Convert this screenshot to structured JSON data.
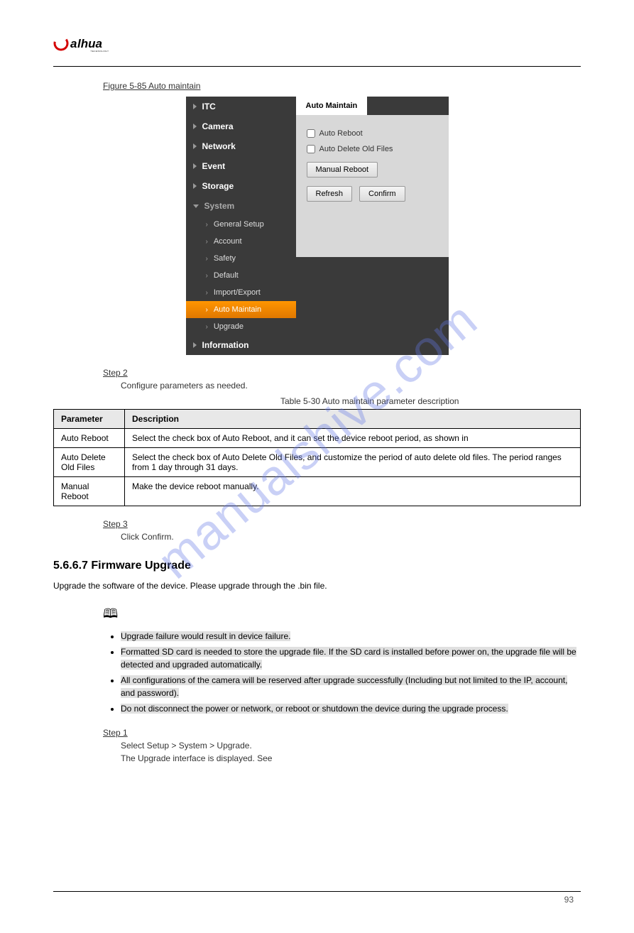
{
  "logo": {
    "brand": "alhua",
    "sub": "TECHNOLOGY"
  },
  "watermark": "manualshive.com",
  "figure_label": "Figure 5-85",
  "figure_title": "Auto maintain",
  "sidebar": {
    "items": [
      {
        "label": "ITC"
      },
      {
        "label": "Camera"
      },
      {
        "label": "Network"
      },
      {
        "label": "Event"
      },
      {
        "label": "Storage"
      }
    ],
    "active_section": "System",
    "subitems": [
      {
        "label": "General Setup"
      },
      {
        "label": "Account"
      },
      {
        "label": "Safety"
      },
      {
        "label": "Default"
      },
      {
        "label": "Import/Export"
      },
      {
        "label": "Auto Maintain",
        "selected": true
      },
      {
        "label": "Upgrade"
      }
    ],
    "last_item": "Information"
  },
  "panel": {
    "tab": "Auto Maintain",
    "check1": "Auto Reboot",
    "check2": "Auto Delete Old Files",
    "btn_manual": "Manual Reboot",
    "btn_refresh": "Refresh",
    "btn_confirm": "Confirm"
  },
  "step2_label": "Step 2",
  "step2_desc": "Configure parameters as needed.",
  "table_caption": "Table 5-30 Auto maintain parameter description",
  "table": {
    "h1": "Parameter",
    "h2": "Description",
    "rows": [
      {
        "p": "Auto Reboot",
        "d": "Select the check box of Auto Reboot, and it can set the device reboot period, as shown in"
      },
      {
        "p": "Auto Delete Old Files",
        "d": "Select the check box of Auto Delete Old Files, and customize the period of auto delete old files. The period ranges from 1 day through 31 days."
      },
      {
        "p": "Manual Reboot",
        "d": "Make the device reboot manually."
      }
    ]
  },
  "step3_label": "Step 3",
  "step3_desc": "Click Confirm.",
  "section": {
    "num": "5.6.6.7",
    "title": "Firmware Upgrade",
    "text": "Upgrade the software of the device. Please upgrade through the .bin file."
  },
  "notes": [
    "Upgrade failure would result in device failure.",
    "Formatted SD card is needed to store the upgrade file. If the SD card is installed before power on, the upgrade file will be detected and upgraded automatically.",
    "All configurations of the camera will be reserved after upgrade successfully (Including but not limited to the IP, account, and password).",
    "Do not disconnect the power or network, or reboot or shutdown the device during the upgrade process."
  ],
  "step1_label": "Step 1",
  "step1_desc_a": "Select Setup > System > Upgrade.",
  "step1_desc_b": "The Upgrade interface is displayed. See",
  "page_number": "93"
}
